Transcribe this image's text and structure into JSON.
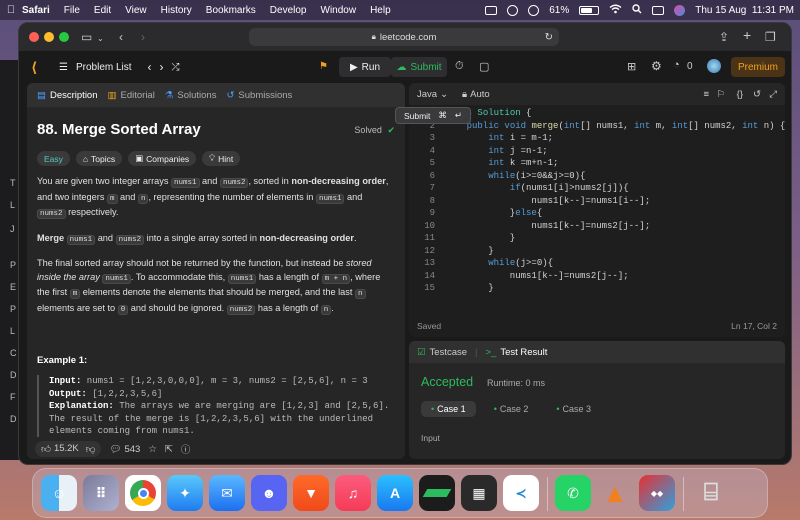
{
  "menubar": {
    "apple": "",
    "app_name": "Safari",
    "items": [
      "File",
      "Edit",
      "View",
      "History",
      "Bookmarks",
      "Develop",
      "Window",
      "Help"
    ],
    "battery": "61%",
    "datetime": "Thu 15 Aug  11:31 PM"
  },
  "browser": {
    "url": "leetcode.com"
  },
  "lc_nav": {
    "problem_list": "Problem List",
    "run": "Run",
    "submit": "Submit",
    "streak": "0",
    "premium": "Premium"
  },
  "tooltip": {
    "label": "Submit",
    "shortcut_cmd": "⌘",
    "shortcut_enter": "↵"
  },
  "left_tabs": {
    "description": "Description",
    "editorial": "Editorial",
    "solutions": "Solutions",
    "submissions": "Submissions"
  },
  "problem": {
    "title": "88. Merge Sorted Array",
    "status": "Solved",
    "difficulty": "Easy",
    "topics": "Topics",
    "companies": "Companies",
    "hint": "Hint",
    "p1_a": "You are given two integer arrays ",
    "p1_nums1": "nums1",
    "p1_b": " and ",
    "p1_nums2": "nums2",
    "p1_c": ", sorted in ",
    "p1_bold": "non-decreasing order",
    "p1_d": ", and two integers ",
    "p1_m": "m",
    "p1_e": " and ",
    "p1_n": "n",
    "p1_f": ", representing the number of elements in ",
    "p1_nums1b": "nums1",
    "p1_g": " and ",
    "p1_nums2b": "nums2",
    "p1_h": " respectively.",
    "p2_bold1": "Merge",
    "p2_nums1": "nums1",
    "p2_a": " and ",
    "p2_nums2": "nums2",
    "p2_b": " into a single array sorted in ",
    "p2_bold2": "non-decreasing order",
    "p2_c": ".",
    "p3_a": "The final sorted array should not be returned by the function, but instead be ",
    "p3_ital": "stored inside the array ",
    "p3_nums1": "nums1",
    "p3_b": ". To accommodate this, ",
    "p3_nums1b": "nums1",
    "p3_c": " has a length of ",
    "p3_mn": "m + n",
    "p3_d": ", where the first ",
    "p3_m": "m",
    "p3_e": " elements denote the elements that should be merged, and the last ",
    "p3_n": "n",
    "p3_f": " elements are set to ",
    "p3_zero": "0",
    "p3_g": " and should be ignored. ",
    "p3_nums2": "nums2",
    "p3_h": " has a length of ",
    "p3_n2": "n",
    "p3_i": ".",
    "example_title": "Example 1:",
    "ex_input_label": "Input:",
    "ex_input": " nums1 = [1,2,3,0,0,0], m = 3, nums2 = [2,5,6], n = 3",
    "ex_output_label": "Output:",
    "ex_output": " [1,2,2,3,5,6]",
    "ex_expl_label": "Explanation:",
    "ex_expl1": " The arrays we are merging are [1,2,3] and [2,5,6].",
    "ex_expl2": "The result of the merge is [1,2,2,3,5,6] with the underlined",
    "ex_expl3": "elements coming from nums1."
  },
  "left_footer": {
    "likes": "15.2K",
    "comments": "543"
  },
  "editor": {
    "language": "Java",
    "mode": "Auto",
    "saved": "Saved",
    "position": "Ln 17, Col 2",
    "lines": [
      {
        "n": "1",
        "t": "class Solution {"
      },
      {
        "n": "2",
        "t": "    public void merge(int[] nums1, int m, int[] nums2, int n) {"
      },
      {
        "n": "3",
        "t": "        int i = m-1;"
      },
      {
        "n": "4",
        "t": "        int j =n-1;"
      },
      {
        "n": "5",
        "t": "        int k =m+n-1;"
      },
      {
        "n": "6",
        "t": "        while(i>=0&&j>=0){"
      },
      {
        "n": "7",
        "t": "            if(nums1[i]>nums2[j]){"
      },
      {
        "n": "8",
        "t": "                nums1[k--]=nums1[i--];"
      },
      {
        "n": "9",
        "t": "            }else{"
      },
      {
        "n": "10",
        "t": "                nums1[k--]=nums2[j--];"
      },
      {
        "n": "11",
        "t": "            }"
      },
      {
        "n": "12",
        "t": "        }"
      },
      {
        "n": "13",
        "t": "        while(j>=0){"
      },
      {
        "n": "14",
        "t": "            nums1[k--]=nums2[j--];"
      },
      {
        "n": "15",
        "t": "        }"
      }
    ]
  },
  "test": {
    "tab_testcase": "Testcase",
    "tab_result": "Test Result",
    "status": "Accepted",
    "runtime": "Runtime: 0 ms",
    "cases": [
      "Case 1",
      "Case 2",
      "Case 3"
    ],
    "input_label": "Input"
  },
  "dock_apps": [
    "Finder",
    "Launchpad",
    "Chrome",
    "Safari",
    "Mail",
    "Discord",
    "Brave",
    "Music",
    "App Store",
    "Terminal",
    "Calculator",
    "VS Code",
    "WhatsApp",
    "VLC",
    "Ludo King",
    "Trash"
  ],
  "colors": {
    "accent_green": "#2cbb5d",
    "easy": "#4ecdc4",
    "premium": "#f0a020",
    "bg_dark": "#1a1a1a"
  }
}
